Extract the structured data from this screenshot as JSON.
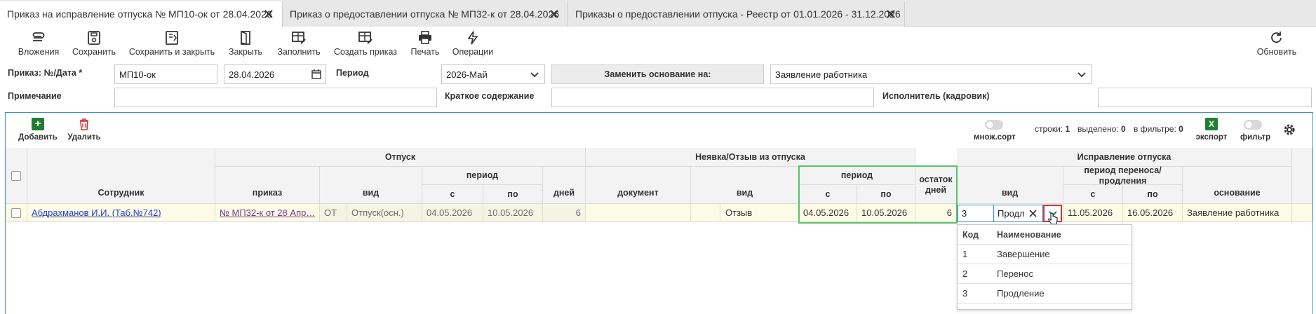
{
  "tabs": [
    {
      "label": "Приказ на исправление отпуска № МП10-ок от 28.04.2026"
    },
    {
      "label": "Приказ о предоставлении отпуска № МП32-к от 28.04.2026"
    },
    {
      "label": "Приказы о предоставлении отпуска - Реестр от 01.01.2026 - 31.12.2026"
    }
  ],
  "toolbar": {
    "attachments": "Вложения",
    "save": "Сохранить",
    "save_close": "Сохранить и закрыть",
    "close": "Закрыть",
    "fill": "Заполнить",
    "create_order": "Создать приказ",
    "print": "Печать",
    "operations": "Операции",
    "refresh": "Обновить"
  },
  "form": {
    "order_label": "Приказ: №/Дата *",
    "order_number": "МП10-ок",
    "order_date": "28.04.2026",
    "period_label": "Период",
    "period_value": "2026-Май",
    "replace_basis_button": "Заменить основание на:",
    "basis_value": "Заявление работника",
    "note_label": "Примечание",
    "note_value": "",
    "summary_label": "Краткое содержание",
    "summary_value": "",
    "executor_label": "Исполнитель (кадровик)",
    "executor_value": ""
  },
  "grid": {
    "add": "Добавить",
    "delete": "Удалить",
    "multisort": "множ.сорт",
    "rows_label": "строки:",
    "rows_count": "1",
    "selected_label": "выделено:",
    "selected_count": "0",
    "filtered_label": "в фильтре:",
    "filtered_count": "0",
    "export": "экспорт",
    "filter": "фильтр",
    "headers": {
      "employee": "Сотрудник",
      "vacation": "Отпуск",
      "order": "приказ",
      "kind": "вид",
      "period": "период",
      "from": "с",
      "to": "по",
      "days": "дней",
      "absence": "Неявка/Отзыв из отпуска",
      "document": "документ",
      "absence_kind": "вид",
      "absence_period": "период",
      "absence_from": "с",
      "absence_to": "по",
      "remaining_days": "остаток дней",
      "correction": "Исправление отпуска",
      "correction_kind": "вид",
      "transfer_period": "период переноса/продления",
      "transfer_from": "с",
      "transfer_to": "по",
      "basis": "основание"
    },
    "row": {
      "employee": "Абдрахманов И.И. (Таб.№742)",
      "order": "№ МП32-к от 28 Апр…",
      "kind_code": "ОТ",
      "kind": "Отпуск(осн.)",
      "from": "04.05.2026",
      "to": "10.05.2026",
      "days": "6",
      "document": "",
      "absence_kind": "Отзыв",
      "absence_from": "04.05.2026",
      "absence_to": "10.05.2026",
      "remaining": "6",
      "correction_code": "3",
      "correction_kind": "Продл",
      "transfer_from": "11.05.2026",
      "transfer_to": "16.05.2026",
      "basis": "Заявление работника"
    },
    "dropdown": {
      "code_header": "Код",
      "name_header": "Наименование",
      "options": [
        {
          "code": "1",
          "name": "Завершение"
        },
        {
          "code": "2",
          "name": "Перенос"
        },
        {
          "code": "3",
          "name": "Продление"
        }
      ]
    }
  },
  "colors": {
    "accent_blue": "#3b8fd4",
    "green": "#1e7e34",
    "red": "#d0343a",
    "row_bg": "#fbfbe6",
    "highlight_green": "#5cc26a"
  }
}
